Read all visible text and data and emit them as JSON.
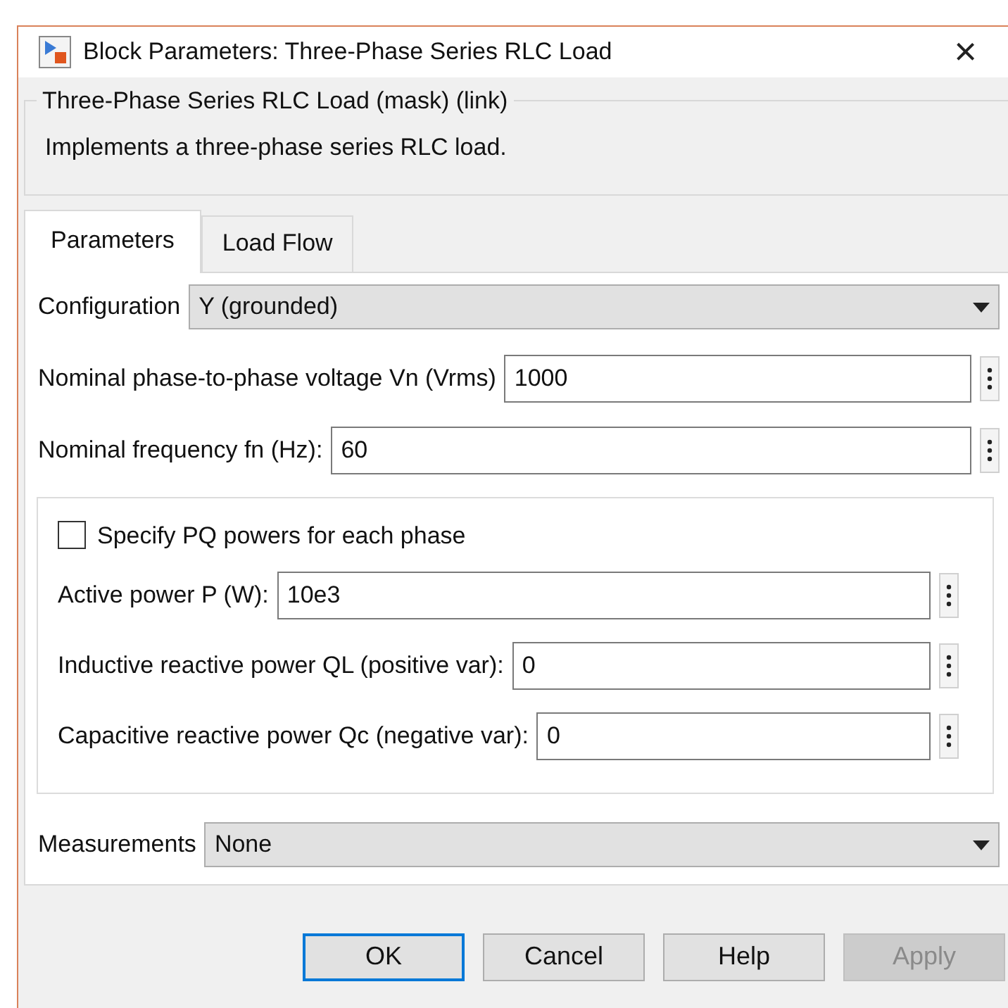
{
  "window": {
    "title": "Block Parameters: Three-Phase Series RLC Load",
    "close": "×"
  },
  "mask": {
    "title": "Three-Phase Series RLC Load (mask) (link)",
    "description": "Implements a three-phase series RLC load."
  },
  "tabs": [
    {
      "label": "Parameters",
      "selected": true
    },
    {
      "label": "Load Flow",
      "selected": false
    }
  ],
  "parameters": [
    {
      "kind": "dropdown",
      "label": "Configuration",
      "value": "Y (grounded)"
    },
    {
      "kind": "field",
      "label": "Nominal phase-to-phase voltage Vn (Vrms)",
      "value": "1000"
    },
    {
      "kind": "field",
      "label": "Nominal frequency fn (Hz):",
      "value": "60"
    },
    {
      "kind": "group",
      "checkbox": {
        "label": "Specify PQ powers for each phase",
        "checked": false
      },
      "fields": [
        {
          "label": "Active power P (W):",
          "value": "10e3"
        },
        {
          "label": "Inductive reactive power QL (positive var):",
          "value": "0"
        },
        {
          "label": "Capacitive reactive power Qc (negative var):",
          "value": "0"
        }
      ]
    },
    {
      "kind": "dropdown",
      "label": "Measurements",
      "value": "None"
    }
  ],
  "buttons": [
    {
      "label": "OK",
      "focused": true,
      "disabled": false
    },
    {
      "label": "Cancel",
      "focused": false,
      "disabled": false
    },
    {
      "label": "Help",
      "focused": false,
      "disabled": false
    },
    {
      "label": "Apply",
      "focused": false,
      "disabled": true
    }
  ]
}
